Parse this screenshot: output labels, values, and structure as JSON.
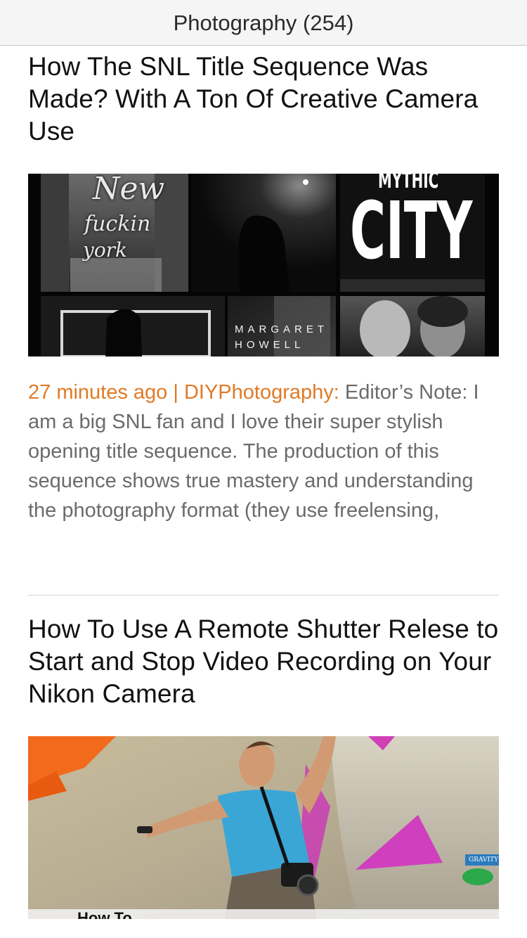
{
  "nav": {
    "title": "Photography (254)"
  },
  "articles": [
    {
      "title": "How The SNL Title Sequence Was Made? With A Ton Of Creative Camera Use",
      "thumbnail": {
        "script_line1": "New",
        "script_line2": "fuckin",
        "script_line3": "york",
        "city_top": "MYTHIC",
        "city_big": "CITY",
        "margaret": "MARGARET",
        "howell": "HOWELL"
      },
      "meta": "27 minutes ago | DIYPhotography:",
      "summary": " Editor’s Note:  I am a big SNL fan and I love their super stylish opening title sequence. The production of this sequence shows true mastery and understanding the photography format (they use freelensing,"
    },
    {
      "title": "How To Use A Remote Shutter Relese to Start and Stop Video Recording on Your Nikon Camera",
      "thumbnail": {
        "badge": "GRAVITY",
        "overlay": "How To"
      }
    }
  ],
  "colors": {
    "meta": "#e07a26",
    "summary": "#6b6b6b",
    "title": "#111111"
  }
}
